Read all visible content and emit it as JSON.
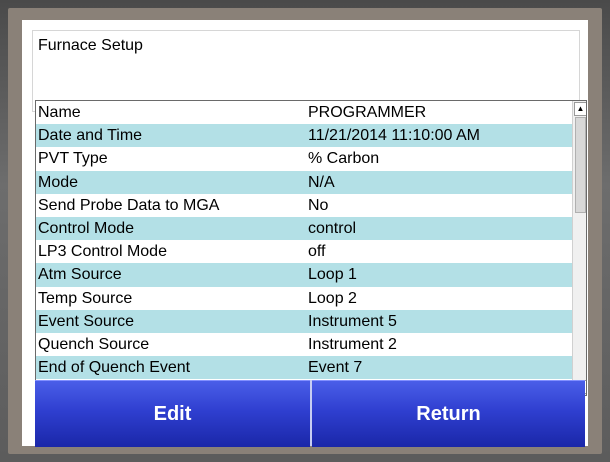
{
  "screen": {
    "title": "Furnace Setup"
  },
  "table": {
    "rows": [
      {
        "key": "Name",
        "value": "PROGRAMMER"
      },
      {
        "key": "Date and Time",
        "value": "11/21/2014 11:10:00 AM"
      },
      {
        "key": "PVT Type",
        "value": "% Carbon"
      },
      {
        "key": "Mode",
        "value": "N/A"
      },
      {
        "key": "Send Probe Data to MGA",
        "value": "No"
      },
      {
        "key": "Control Mode",
        "value": "control"
      },
      {
        "key": "LP3 Control Mode",
        "value": "off"
      },
      {
        "key": "Atm Source",
        "value": "Loop 1"
      },
      {
        "key": "Temp Source",
        "value": "Loop 2"
      },
      {
        "key": "Event Source",
        "value": "Instrument 5"
      },
      {
        "key": "Quench Source",
        "value": "Instrument 2"
      },
      {
        "key": "End of Quench Event",
        "value": "Event 7"
      }
    ]
  },
  "buttons": {
    "edit_label": "Edit",
    "return_label": "Return"
  },
  "colors": {
    "row_alt": "#b3e0e6",
    "button_blue": "#2f3fd0"
  },
  "icons": {
    "scroll_up": "arrow-up-icon",
    "scroll_down": "arrow-down-icon"
  }
}
